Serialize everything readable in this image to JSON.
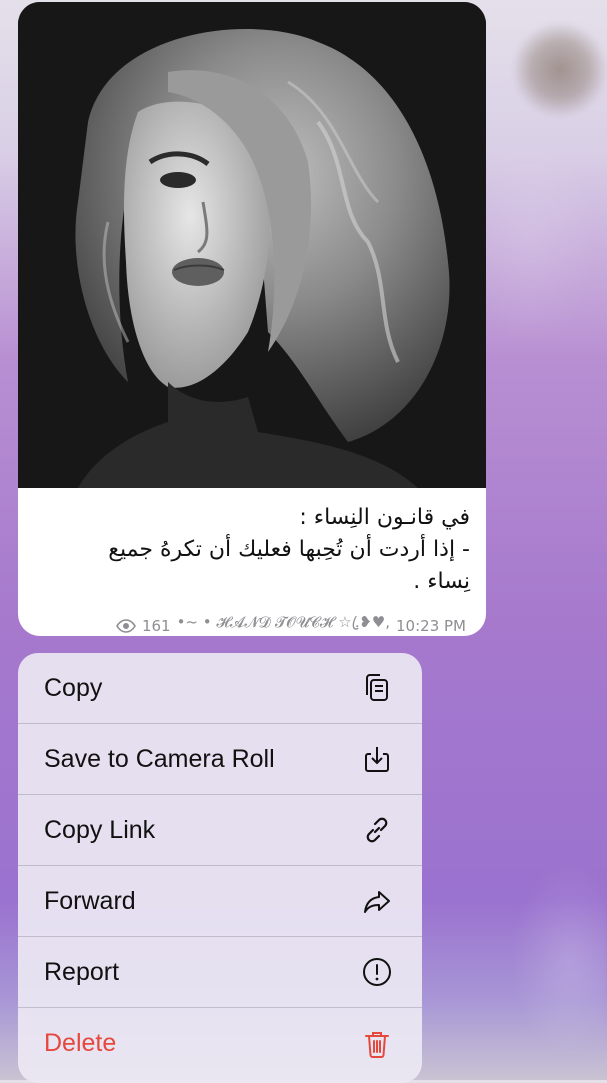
{
  "message": {
    "caption_lines": [
      "في قانـون النِساء :",
      "- إذا أردت أن تُحِبها فعليك أن تكرهُ جميع",
      "نِساء ."
    ],
    "views": "161",
    "signature": "•~ • 𝓗𝓐𝓝𝓓 𝓣𝓞𝓤𝓒𝓗 ☆.ꦿ❥♥,",
    "time": "10:23 PM",
    "views_icon": "eye-icon",
    "photo_subject": "woman-portrait"
  },
  "menu": {
    "items": [
      {
        "label": "Copy",
        "icon": "copy-icon"
      },
      {
        "label": "Save to Camera Roll",
        "icon": "save-icon"
      },
      {
        "label": "Copy Link",
        "icon": "link-icon"
      },
      {
        "label": "Forward",
        "icon": "forward-icon"
      },
      {
        "label": "Report",
        "icon": "report-icon"
      },
      {
        "label": "Delete",
        "icon": "trash-icon"
      }
    ]
  },
  "colors": {
    "danger": "#e5483d",
    "meta_text": "#8e8e93"
  }
}
